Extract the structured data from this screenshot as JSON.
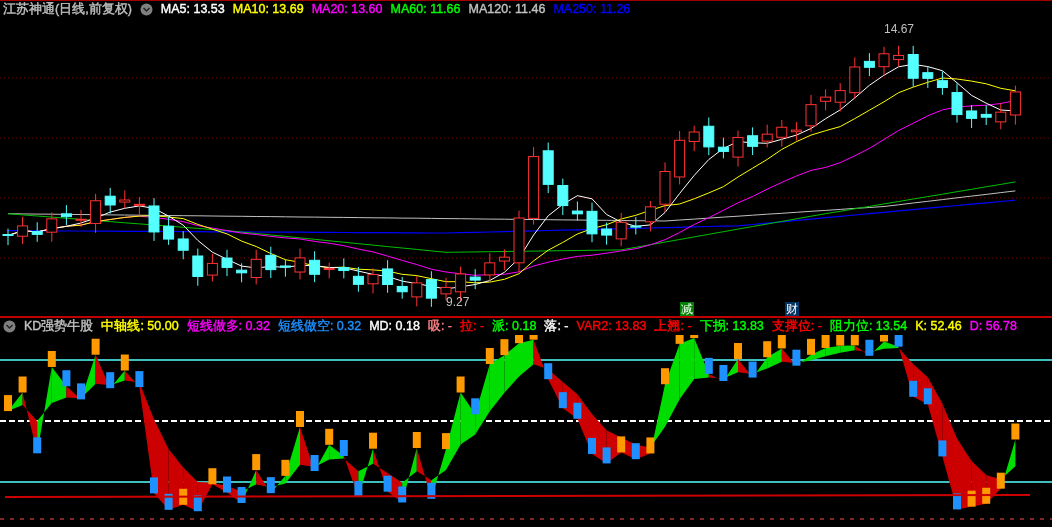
{
  "main_panel": {
    "title": "江苏神通(日线,前复权)",
    "indicators": [
      {
        "label": "MA5: 13.53",
        "color": "#ffffff"
      },
      {
        "label": "MA10: 13.69",
        "color": "#ffff00"
      },
      {
        "label": "MA20: 13.60",
        "color": "#ff00ff"
      },
      {
        "label": "MA60: 11.66",
        "color": "#00ff00"
      },
      {
        "label": "MA120: 11.46",
        "color": "#c0c0c0"
      },
      {
        "label": "MA250: 11.26",
        "color": "#0000ff"
      }
    ],
    "high_label": "14.67",
    "low_label": "9.27",
    "markers": [
      {
        "text": "减",
        "color": "#008000"
      },
      {
        "text": "财",
        "color": "#003366"
      }
    ]
  },
  "sub_panel": {
    "title": "KD强势牛股",
    "indicators": [
      {
        "label": "中轴线: 50.00",
        "color": "#ffff00"
      },
      {
        "label": "短线做多: 0.32",
        "color": "#ff00ff"
      },
      {
        "label": "短线做空: 0.32",
        "color": "#1e90ff"
      },
      {
        "label": "MD: 0.18",
        "color": "#ffffff"
      },
      {
        "label": "吸: -",
        "color": "#ff8080"
      },
      {
        "label": "拉: -",
        "color": "#ff0000"
      },
      {
        "label": "派: 0.18",
        "color": "#00ff00"
      },
      {
        "label": "落: -",
        "color": "#ffffff"
      },
      {
        "label": "VAR2: 13.83",
        "color": "#ff0000"
      },
      {
        "label": "上翘: -",
        "color": "#ff0000"
      },
      {
        "label": "下拐: 13.83",
        "color": "#00ff00"
      },
      {
        "label": "支撑位: -",
        "color": "#ff0000"
      },
      {
        "label": "阻力位: 13.54",
        "color": "#00ff00"
      },
      {
        "label": "K: 52.46",
        "color": "#ffff00"
      },
      {
        "label": "D: 56.78",
        "color": "#ff00ff"
      }
    ]
  }
}
